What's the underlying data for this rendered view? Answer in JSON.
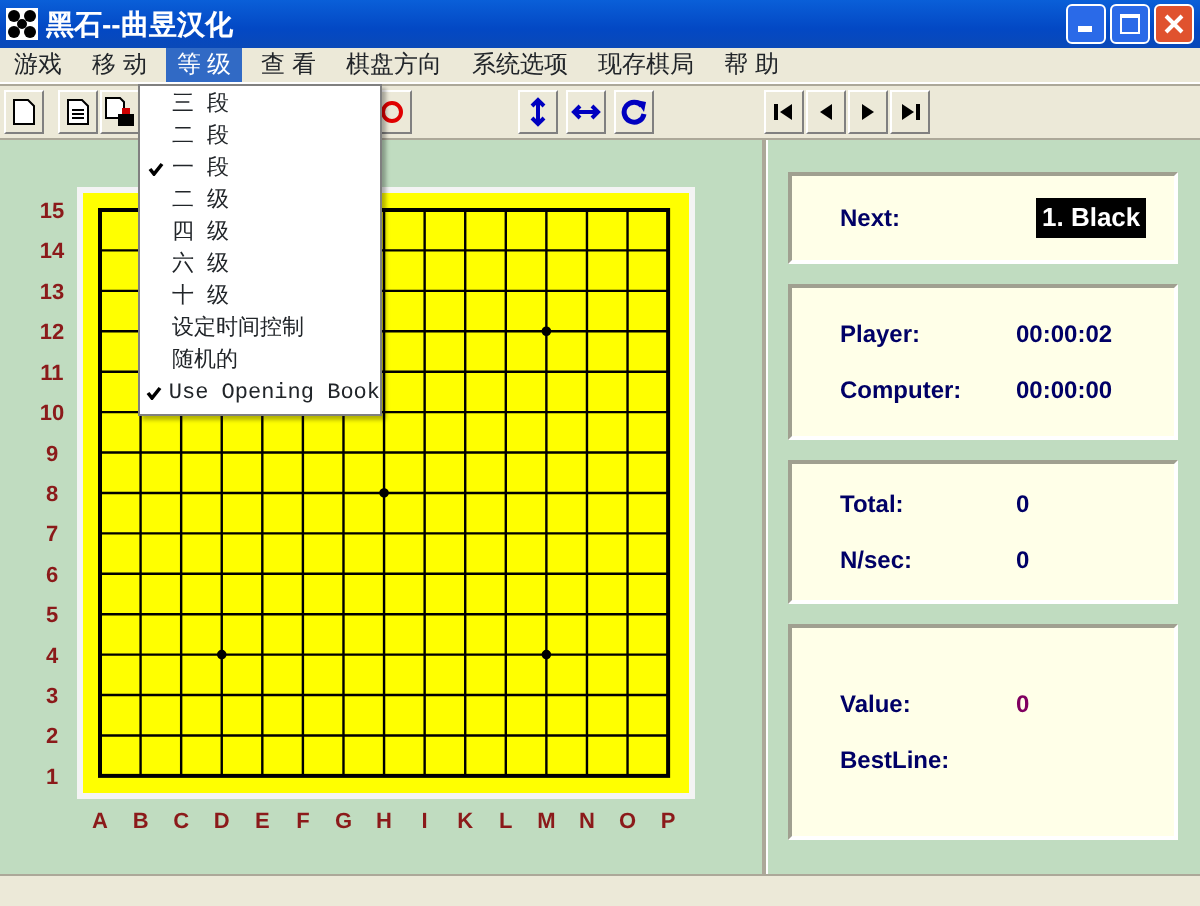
{
  "window": {
    "title": "黑石--曲昱汉化"
  },
  "menu": [
    {
      "label": "游戏",
      "selected": false
    },
    {
      "label": "移 动",
      "selected": false
    },
    {
      "label": "等 级",
      "selected": true
    },
    {
      "label": "查 看",
      "selected": false
    },
    {
      "label": "棋盘方向",
      "selected": false
    },
    {
      "label": "系统选项",
      "selected": false
    },
    {
      "label": "现存棋局",
      "selected": false
    },
    {
      "label": "帮 助",
      "selected": false
    }
  ],
  "dropdown": {
    "items": [
      {
        "label": "三 段",
        "checked": false
      },
      {
        "label": "二 段",
        "checked": false
      },
      {
        "label": "一 段",
        "checked": true
      },
      {
        "label": "二 级",
        "checked": false
      },
      {
        "label": "四 级",
        "checked": false
      },
      {
        "label": "六 级",
        "checked": false
      },
      {
        "label": "十 级",
        "checked": false
      },
      {
        "label": "设定时间控制",
        "checked": false
      },
      {
        "label": "随机的",
        "checked": false
      },
      {
        "label": "Use Opening Book",
        "checked": true
      }
    ]
  },
  "board": {
    "row_labels": [
      "15",
      "14",
      "13",
      "12",
      "11",
      "10",
      "9",
      "8",
      "7",
      "6",
      "5",
      "4",
      "3",
      "2",
      "1"
    ],
    "column_labels": [
      "A",
      "B",
      "C",
      "D",
      "E",
      "F",
      "G",
      "H",
      "I",
      "K",
      "L",
      "M",
      "N",
      "O",
      "P"
    ]
  },
  "panels": [
    {
      "rows": [
        {
          "label": "Next:",
          "value": "1. Black",
          "kind": "highlight"
        }
      ]
    },
    {
      "rows": [
        {
          "label": "Player:",
          "value": "00:00:02",
          "kind": "plain"
        },
        {
          "label": "Computer:",
          "value": "00:00:00",
          "kind": "plain"
        }
      ]
    },
    {
      "rows": [
        {
          "label": "Total:",
          "value": "0",
          "kind": "plain"
        },
        {
          "label": "N/sec:",
          "value": "0",
          "kind": "plain"
        }
      ]
    },
    {
      "rows": [
        {
          "label": "Value:",
          "value": "0",
          "kind": "accent"
        },
        {
          "label": "BestLine:",
          "kind": "plain"
        }
      ]
    }
  ]
}
